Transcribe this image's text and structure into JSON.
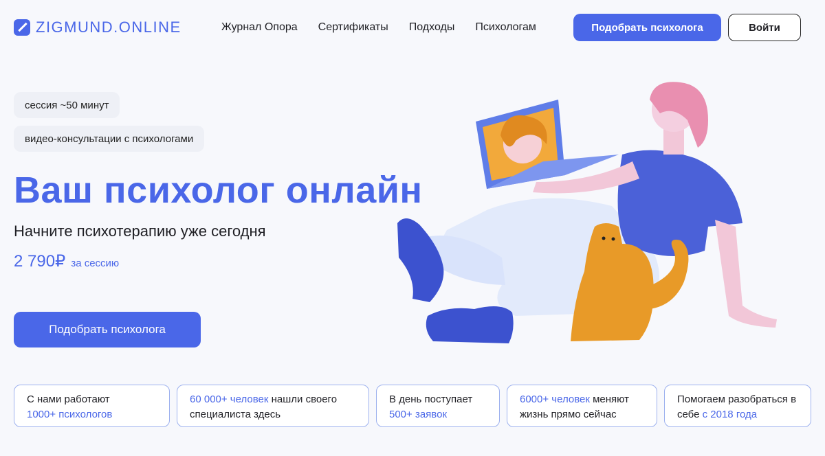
{
  "header": {
    "logo_text": "ZIGMUND.ONLINE",
    "nav": [
      "Журнал Опора",
      "Сертификаты",
      "Подходы",
      "Психологам"
    ],
    "cta_label": "Подобрать психолога",
    "login_label": "Войти"
  },
  "hero": {
    "pill_session": "сессия ~50 минут",
    "pill_video": "видео-консультации с психологами",
    "title": "Ваш психолог онлайн",
    "subtitle": "Начните психотерапию уже сегодня",
    "price_value": "2 790₽",
    "price_unit": "за сессию",
    "cta_label": "Подобрать психолога"
  },
  "stats": [
    {
      "pre": "С нами работают",
      "hl": "1000+ психологов",
      "post": ""
    },
    {
      "pre": "",
      "hl": "60 000+ человек",
      "post": " нашли своего специалиста здесь"
    },
    {
      "pre": "В день поступает",
      "hl": "500+ заявок",
      "post": ""
    },
    {
      "pre": "",
      "hl": "6000+ человек",
      "post": " меняют жизнь прямо сейчас"
    },
    {
      "pre": "Помогаем разобраться в себе ",
      "hl": "с 2018 года",
      "post": ""
    }
  ],
  "colors": {
    "accent": "#4a67e8",
    "background": "#f7f8fc",
    "stat_border": "#9cb0ee"
  },
  "icons": {
    "logo": "zigmund-logo-icon",
    "illustration": "woman-laptop-cat-illustration"
  }
}
